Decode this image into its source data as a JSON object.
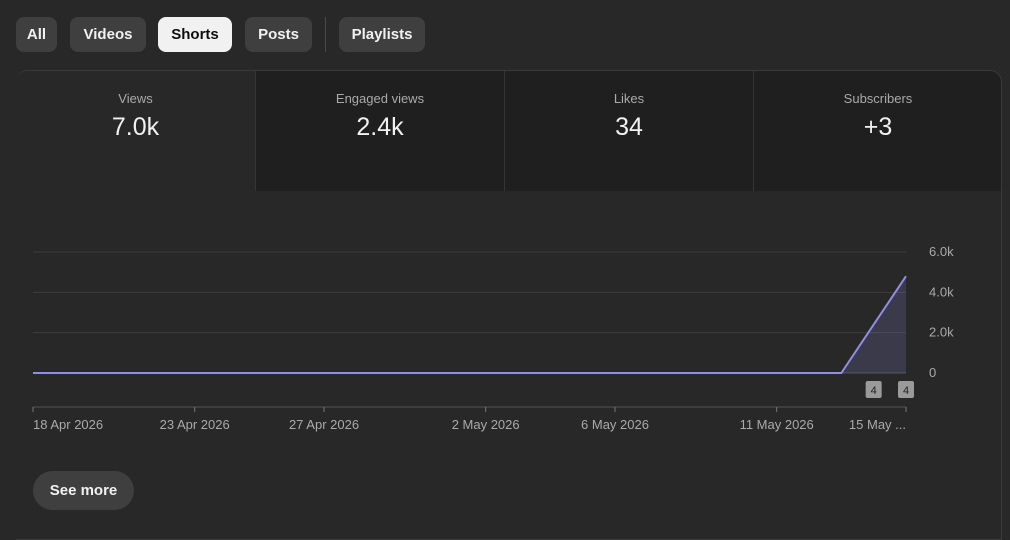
{
  "tabs": [
    {
      "label": "All",
      "active": false
    },
    {
      "label": "Videos",
      "active": false
    },
    {
      "label": "Shorts",
      "active": true
    },
    {
      "label": "Posts",
      "active": false
    },
    {
      "label": "Playlists",
      "active": false
    }
  ],
  "metrics": [
    {
      "label": "Views",
      "value": "7.0k",
      "selected": true
    },
    {
      "label": "Engaged views",
      "value": "2.4k",
      "selected": false
    },
    {
      "label": "Likes",
      "value": "34",
      "selected": false
    },
    {
      "label": "Subscribers",
      "value": "+3",
      "selected": false
    }
  ],
  "chart_data": {
    "type": "area",
    "title": "",
    "series": [
      {
        "values": [
          0,
          0,
          0,
          0,
          0,
          0,
          0,
          0,
          0,
          0,
          0,
          0,
          0,
          0,
          0,
          0,
          0,
          0,
          0,
          0,
          0,
          0,
          0,
          0,
          0,
          0,
          2400,
          4800
        ],
        "color": "#8e8ee8"
      }
    ],
    "x_tick_labels": [
      "18 Apr 2026",
      "23 Apr 2026",
      "27 Apr 2026",
      "2 May 2026",
      "6 May 2026",
      "11 May 2026",
      "15 May ..."
    ],
    "x_tick_indices": [
      0,
      5,
      9,
      14,
      18,
      23,
      27
    ],
    "y_tick_labels": [
      "6.0k",
      "4.0k",
      "2.0k",
      "0"
    ],
    "y_tick_values": [
      6000,
      4000,
      2000,
      0
    ],
    "ylim": [
      0,
      6000
    ],
    "grid": true,
    "markers": [
      {
        "label": "4",
        "index": 26
      },
      {
        "label": "4",
        "index": 27
      }
    ]
  },
  "see_more_label": "See more"
}
